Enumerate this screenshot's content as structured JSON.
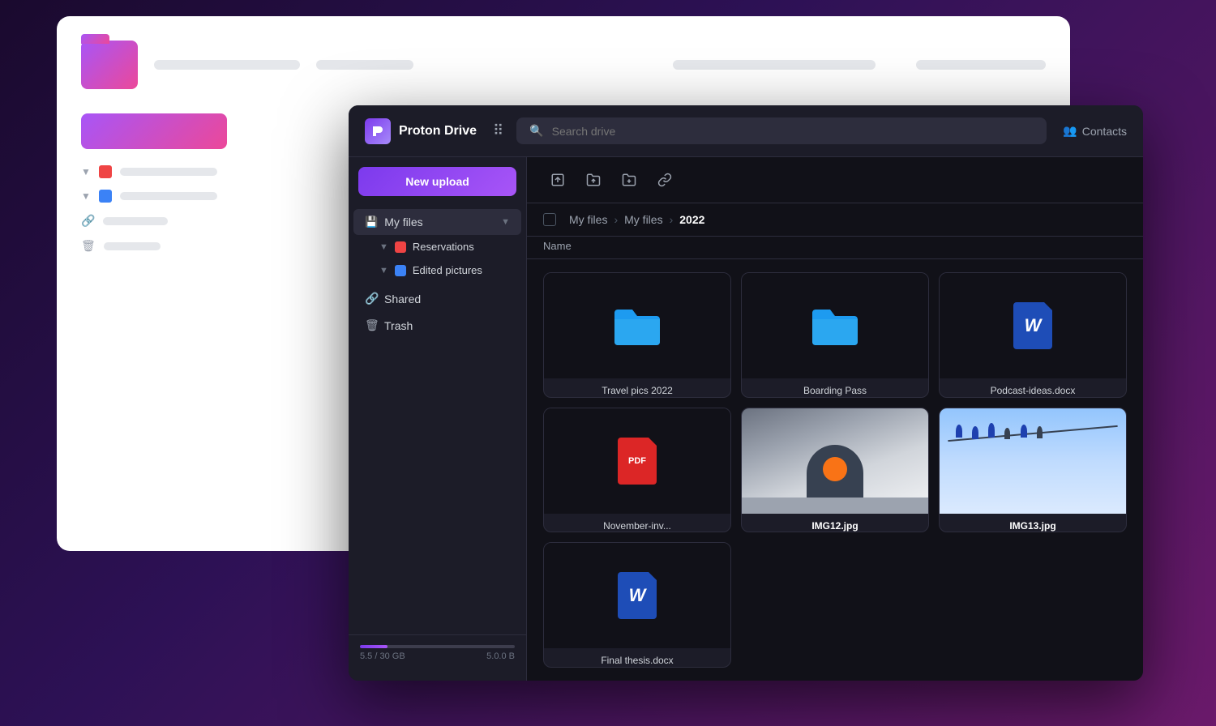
{
  "background": {
    "gradient_start": "#1a0a2e",
    "gradient_end": "#6b1a6b"
  },
  "proton_drive": {
    "brand_name": "Proton Drive",
    "search_placeholder": "Search drive",
    "header_right": {
      "contacts_label": "Contacts"
    },
    "toolbar": {
      "upload_file": "Upload file",
      "upload_folder": "Upload folder",
      "new_folder": "New folder",
      "get_link": "Get link"
    },
    "new_upload_label": "New upload",
    "sidebar": {
      "my_files_label": "My files",
      "items": [
        {
          "label": "Reservations",
          "color": "red",
          "type": "folder"
        },
        {
          "label": "Edited pictures",
          "color": "blue",
          "type": "folder"
        }
      ],
      "shared_label": "Shared",
      "trash_label": "Trash",
      "storage": {
        "used": "5.5",
        "total": "30 GB",
        "file_size": "5.0.0 B",
        "percent": 18
      }
    },
    "breadcrumb": {
      "parts": [
        "My files",
        "My files",
        "2022"
      ]
    },
    "column_header": "Name",
    "files": [
      {
        "id": "1",
        "name": "Travel pics 2022",
        "type": "folder",
        "preview": "folder"
      },
      {
        "id": "2",
        "name": "Boarding Pass",
        "type": "folder",
        "preview": "folder"
      },
      {
        "id": "3",
        "name": "Podcast-ideas.docx",
        "type": "docx",
        "preview": "word"
      },
      {
        "id": "4",
        "name": "November-inv...",
        "type": "pdf",
        "preview": "pdf"
      },
      {
        "id": "5",
        "name": "IMG12.jpg",
        "type": "image",
        "preview": "photo1",
        "bold": true
      },
      {
        "id": "6",
        "name": "IMG13.jpg",
        "type": "image",
        "preview": "photo2",
        "bold": true
      },
      {
        "id": "7",
        "name": "Final thesis.docx",
        "type": "docx",
        "preview": "word"
      }
    ]
  }
}
